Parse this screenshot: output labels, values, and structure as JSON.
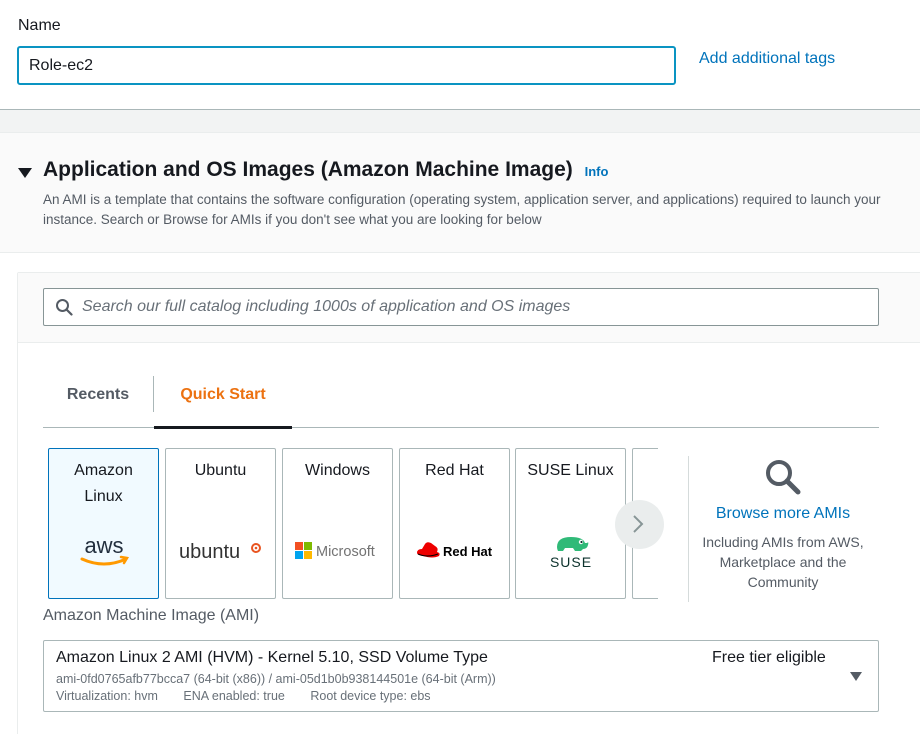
{
  "name_section": {
    "label": "Name",
    "value": "Role-ec2",
    "add_tags": "Add additional tags"
  },
  "ami_section": {
    "title": "Application and OS Images (Amazon Machine Image)",
    "info": "Info",
    "description": "An AMI is a template that contains the software configuration (operating system, application server, and applications) required to launch your instance. Search or Browse for AMIs if you don't see what you are looking for below",
    "search_placeholder": "Search our full catalog including 1000s of application and OS images",
    "tabs": [
      {
        "label": "Recents",
        "active": false
      },
      {
        "label": "Quick Start",
        "active": true
      }
    ],
    "os_tiles": [
      {
        "name": "Amazon Linux",
        "logo": "aws-logo",
        "selected": true
      },
      {
        "name": "Ubuntu",
        "logo": "ubuntu-logo",
        "selected": false
      },
      {
        "name": "Windows",
        "logo": "microsoft-logo",
        "selected": false
      },
      {
        "name": "Red Hat",
        "logo": "redhat-logo",
        "selected": false
      },
      {
        "name": "SUSE Linux",
        "logo": "suse-logo",
        "selected": false
      }
    ],
    "logo_text": {
      "aws": "aws",
      "ubuntu": "ubuntu",
      "microsoft": "Microsoft",
      "redhat": "Red Hat",
      "suse": "SUSE"
    },
    "browse": {
      "link": "Browse more AMIs",
      "description": "Including AMIs from AWS, Marketplace and the Community"
    },
    "ami_label": "Amazon Machine Image (AMI)",
    "selected_ami": {
      "name": "Amazon Linux 2 AMI (HVM) - Kernel 5.10, SSD Volume Type",
      "ids": "ami-0fd0765afb77bcca7 (64-bit (x86)) / ami-05d1b0b938144501e (64-bit (Arm))",
      "virtualization": "Virtualization: hvm",
      "ena": "ENA enabled: true",
      "root_device": "Root device type: ebs",
      "free_tier": "Free tier eligible"
    }
  },
  "colors": {
    "link": "#0073bb",
    "active_tab": "#ec7211",
    "input_focus": "#0a94c2",
    "selected_tile_bg": "#f1faff"
  }
}
